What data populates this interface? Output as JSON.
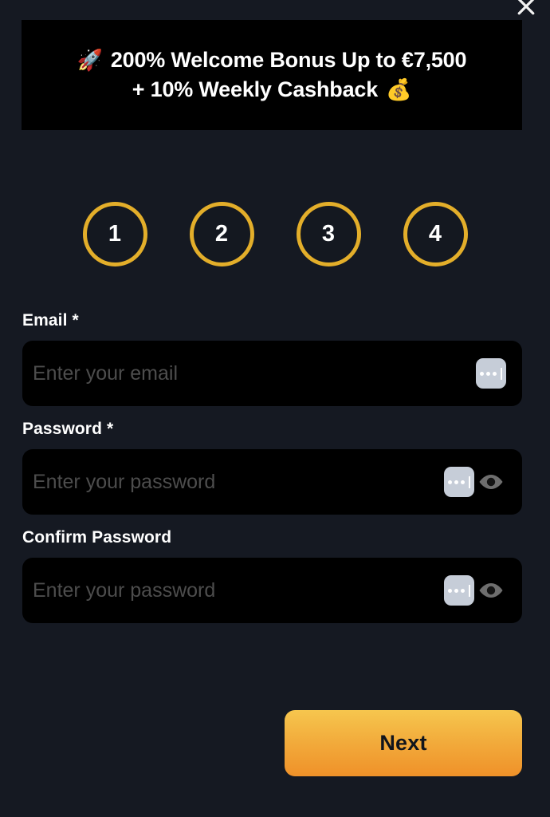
{
  "dialog": {
    "close_label": "close-icon"
  },
  "promo": {
    "rocket_emoji": "🚀",
    "line1": "200% Welcome Bonus Up to €7,500",
    "line2": "+ 10% Weekly Cashback",
    "money_emoji": "💰",
    "background": "#000000"
  },
  "stepper": {
    "steps": [
      {
        "number": "1",
        "active": true
      },
      {
        "number": "2",
        "active": true
      },
      {
        "number": "3",
        "active": true
      },
      {
        "number": "4",
        "active": true
      }
    ],
    "ring_color": "#E3AE2A"
  },
  "form": {
    "email": {
      "label": "Email *",
      "placeholder": "Enter your email",
      "value": ""
    },
    "password": {
      "label": "Password *",
      "placeholder": "Enter your password",
      "value": ""
    },
    "confirm_password": {
      "label": "Confirm Password",
      "placeholder": "Enter your password",
      "value": ""
    }
  },
  "actions": {
    "next_label": "Next",
    "next_gradient_top": "#F6C64E",
    "next_gradient_bottom": "#EF9129"
  },
  "theme": {
    "page_background": "#151922",
    "input_background": "#000000",
    "label_color": "#FFFFFF",
    "placeholder_color": "#4D4D4D"
  }
}
